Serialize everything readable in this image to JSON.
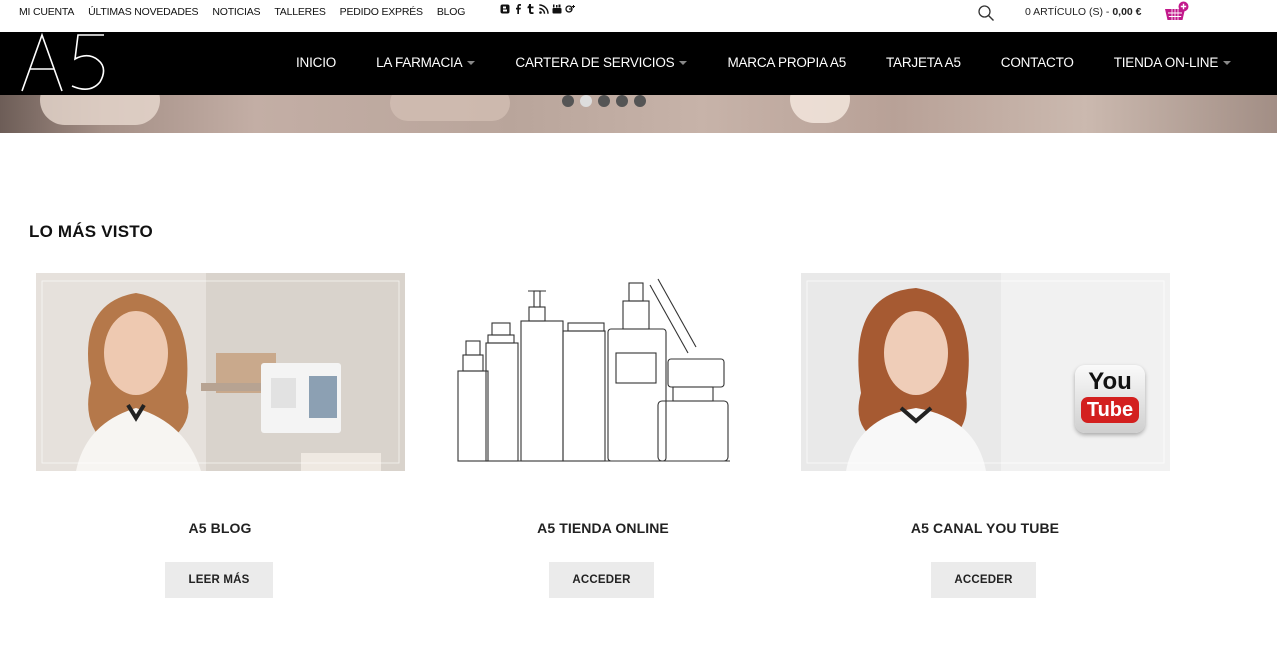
{
  "topbar": {
    "links": [
      "MI CUENTA",
      "ÚLTIMAS NOVEDADES",
      "NOTICIAS",
      "TALLERES",
      "PEDIDO EXPRÉS",
      "BLOG"
    ],
    "social_icons": [
      "blogger-icon",
      "facebook-icon",
      "tumblr-icon",
      "rss-icon",
      "youtube-icon",
      "google-plus-icon"
    ],
    "cart_count_label": "0 ARTÍCULO (S) -",
    "cart_total": "0,00 €"
  },
  "brand": {
    "logo_text": "A5"
  },
  "nav": {
    "items": [
      {
        "label": "INICIO",
        "dropdown": false
      },
      {
        "label": "LA FARMACIA",
        "dropdown": true
      },
      {
        "label": "CARTERA DE SERVICIOS",
        "dropdown": true
      },
      {
        "label": "MARCA PROPIA A5",
        "dropdown": false
      },
      {
        "label": "TARJETA A5",
        "dropdown": false
      },
      {
        "label": "CONTACTO",
        "dropdown": false
      },
      {
        "label": "TIENDA ON-LINE",
        "dropdown": true
      }
    ]
  },
  "slider": {
    "slide_count": 5,
    "active_index": 1
  },
  "section": {
    "title": "LO MÁS VISTO",
    "cards": [
      {
        "title": "A5 BLOG",
        "button": "LEER MÁS"
      },
      {
        "title": "A5 TIENDA ONLINE",
        "button": "ACCEDER"
      },
      {
        "title": "A5 CANAL YOU TUBE",
        "button": "ACCEDER",
        "badge_line1": "You",
        "badge_line2": "Tube"
      }
    ]
  },
  "colors": {
    "navbar": "#000000",
    "accent": "#c2188b",
    "button_bg": "#ebebeb"
  }
}
